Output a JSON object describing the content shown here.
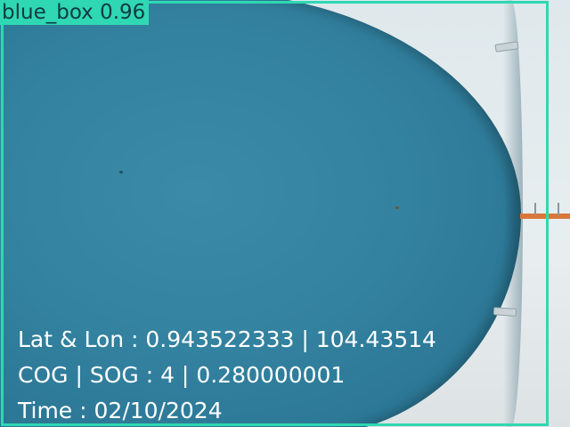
{
  "detection": {
    "class_label": "blue_box",
    "confidence": "0.96",
    "box_color": "#2fd8b2"
  },
  "telemetry": {
    "lat_lon_label": "Lat & Lon",
    "latitude": "0.943522333",
    "longitude": "104.43514",
    "cog_sog_label": "COG | SOG",
    "cog": "4",
    "sog": "0.280000001",
    "time_label": "Time",
    "time": "02/10/2024"
  },
  "colors": {
    "panel_blue": "#3382a0",
    "overlay_text": "#ffffff",
    "rail_orange": "#d9783a"
  }
}
